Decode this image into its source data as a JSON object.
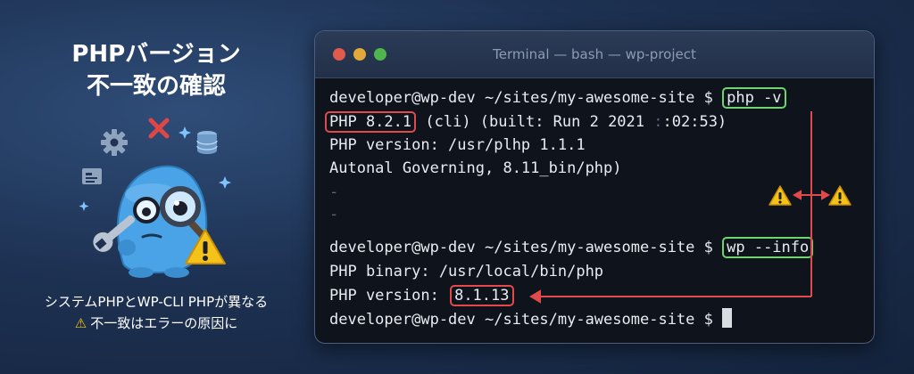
{
  "left": {
    "title_line1": "PHPバージョン",
    "title_line2": "不一致の確認",
    "caption_line1": "システムPHPとWP-CLI PHPが異なる",
    "caption_warn_icon": "⚠",
    "caption_line2": "不一致はエラーの原因に",
    "mascot_icons": [
      "gear-icon",
      "x-mark-icon",
      "database-icon",
      "document-icon",
      "sparkle-icon",
      "wrench-icon",
      "magnifier-icon",
      "warning-icon"
    ]
  },
  "terminal": {
    "window_title": "Terminal — bash — wp-project",
    "prompt": "developer@wp-dev ~/sites/my-awesome-site $",
    "cmd1": "php -v",
    "out1_version": "PHP 8.2.1",
    "out1_rest": "(cli) (built: Run 2 2021",
    "out1_faint": ":",
    "out1_end": ":02:53)",
    "out2": "PHP version: /usr/plhp 1.1.1",
    "out3": "Autonal Governing, 8.11_bin/php)",
    "faint_marks": [
      "-",
      "-"
    ],
    "cmd2": "wp --info",
    "out4": "PHP binary: /usr/local/bin/php",
    "out5_label": "PHP version:",
    "out5_version": "8.1.13"
  },
  "colors": {
    "highlight_red": "#e04a4a",
    "highlight_green": "#6fd46f",
    "warning": "#f5c21a",
    "terminal_bg": "#0f141c"
  }
}
